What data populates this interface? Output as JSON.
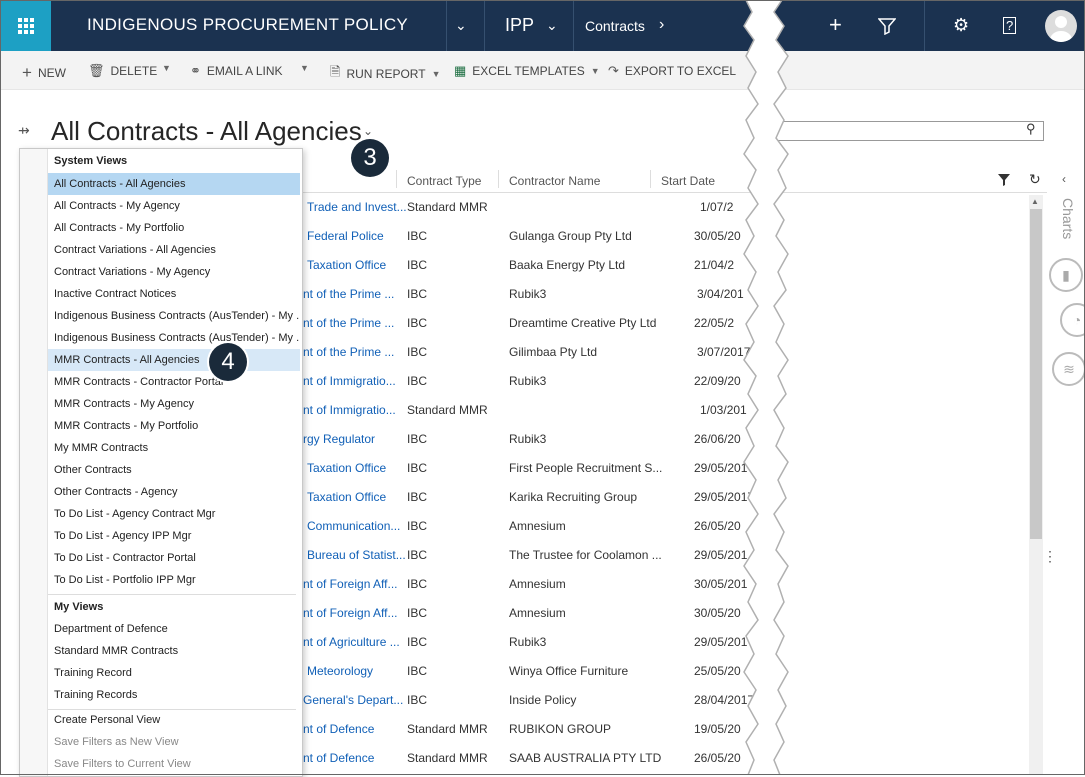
{
  "nav": {
    "app_title": "INDIGENOUS PROCUREMENT POLICY",
    "area": "IPP",
    "entity": "Contracts",
    "colors": {
      "nav_bg": "#1b3250",
      "apps_bg": "#1da0c4"
    }
  },
  "toolbar": {
    "new": "NEW",
    "delete": "DELETE",
    "email_link": "EMAIL A LINK",
    "run_report": "RUN REPORT",
    "excel_templates": "EXCEL TEMPLATES",
    "export_excel": "EXPORT TO EXCEL"
  },
  "view": {
    "title": "All Contracts - All Agencies",
    "badge_3": "3",
    "badge_4": "4"
  },
  "grid": {
    "headers": [
      "Contract Type",
      "Contractor Name",
      "Start Date"
    ],
    "rows": [
      {
        "agency": "Trade and Invest...",
        "type": "Standard MMR",
        "contractor": "",
        "start": "1/07/2"
      },
      {
        "agency": "Federal Police",
        "type": "IBC",
        "contractor": "Gulanga Group Pty Ltd",
        "start": "30/05/20"
      },
      {
        "agency": "Taxation Office",
        "type": "IBC",
        "contractor": "Baaka Energy Pty Ltd",
        "start": "21/04/2"
      },
      {
        "agency": "nt of the Prime ...",
        "type": "IBC",
        "contractor": "Rubik3",
        "start": "3/04/201"
      },
      {
        "agency": "nt of the Prime ...",
        "type": "IBC",
        "contractor": "Dreamtime Creative Pty Ltd",
        "start": "22/05/2"
      },
      {
        "agency": "nt of the Prime ...",
        "type": "IBC",
        "contractor": "Gilimbaa Pty Ltd",
        "start": "3/07/2017"
      },
      {
        "agency": "nt of Immigratio...",
        "type": "IBC",
        "contractor": "Rubik3",
        "start": "22/09/20"
      },
      {
        "agency": "nt of Immigratio...",
        "type": "Standard MMR",
        "contractor": "",
        "start": "1/03/201"
      },
      {
        "agency": "rgy Regulator",
        "type": "IBC",
        "contractor": "Rubik3",
        "start": "26/06/20"
      },
      {
        "agency": "Taxation Office",
        "type": "IBC",
        "contractor": "First People Recruitment S...",
        "start": "29/05/201"
      },
      {
        "agency": "Taxation Office",
        "type": "IBC",
        "contractor": "Karika Recruiting Group",
        "start": "29/05/2017"
      },
      {
        "agency": "Communication...",
        "type": "IBC",
        "contractor": "Amnesium",
        "start": "26/05/20"
      },
      {
        "agency": "Bureau of Statist...",
        "type": "IBC",
        "contractor": "The Trustee for Coolamon ...",
        "start": "29/05/201"
      },
      {
        "agency": "nt of Foreign Aff...",
        "type": "IBC",
        "contractor": "Amnesium",
        "start": "30/05/201"
      },
      {
        "agency": "nt of Foreign Aff...",
        "type": "IBC",
        "contractor": "Amnesium",
        "start": "30/05/20"
      },
      {
        "agency": "nt of Agriculture ...",
        "type": "IBC",
        "contractor": "Rubik3",
        "start": "29/05/201"
      },
      {
        "agency": "Meteorology",
        "type": "IBC",
        "contractor": "Winya Office Furniture",
        "start": "25/05/20"
      },
      {
        "agency": "General's Depart...",
        "type": "IBC",
        "contractor": "Inside Policy",
        "start": "28/04/2017"
      },
      {
        "agency": "nt of Defence",
        "type": "Standard MMR",
        "contractor": "RUBIKON GROUP",
        "start": "19/05/20"
      },
      {
        "agency": "nt of Defence",
        "type": "Standard MMR",
        "contractor": "SAAB AUSTRALIA PTY LTD",
        "start": "26/05/20"
      }
    ]
  },
  "side_panel": {
    "label": "Charts"
  },
  "dropdown": {
    "system_views_heading": "System Views",
    "system_views": [
      "All Contracts - All Agencies",
      "All Contracts - My Agency",
      "All Contracts - My Portfolio",
      "Contract Variations - All Agencies",
      "Contract Variations - My Agency",
      "Inactive Contract Notices",
      "Indigenous Business Contracts (AusTender) - My ...",
      "Indigenous Business Contracts (AusTender) - My ...",
      "MMR Contracts - All Agencies",
      "MMR Contracts - Contractor Portal",
      "MMR Contracts - My Agency",
      "MMR Contracts - My Portfolio",
      "My MMR Contracts",
      "Other Contracts",
      "Other Contracts - Agency",
      "To Do List - Agency Contract Mgr",
      "To Do List - Agency IPP Mgr",
      "To Do List - Contractor Portal",
      "To Do List - Portfolio IPP Mgr"
    ],
    "my_views_heading": "My Views",
    "my_views": [
      "Department of Defence",
      "Standard MMR Contracts",
      "Training Record",
      "Training Records"
    ],
    "actions": [
      "Create Personal View",
      "Save Filters as New View",
      "Save Filters to Current View"
    ]
  }
}
